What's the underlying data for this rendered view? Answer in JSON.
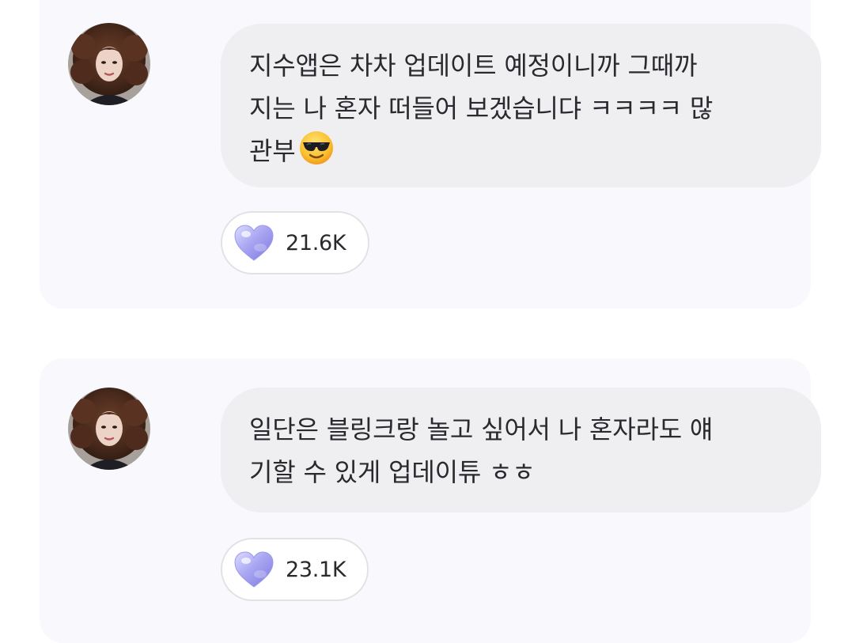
{
  "colors": {
    "card_background": "#f8f8fd",
    "bubble_background": "#efeff1",
    "text": "#2a2a2e",
    "heart": "#a9a6f2"
  },
  "messages": [
    {
      "author_icon": "avatar-icon",
      "lines": [
        "지수앱은 차차 업데이트 예정이니까 그때까",
        "지는 나 혼자 떠들어 보겠습니댜 ㅋㅋㅋㅋ 많",
        "관부"
      ],
      "trailing_emoji": "smiling-face-with-sunglasses-icon",
      "reaction_icon": "crystal-heart-icon",
      "like_count": "21.6K"
    },
    {
      "author_icon": "avatar-icon",
      "lines": [
        "일단은 블링크랑 놀고 싶어서 나 혼자라도 얘",
        "기할 수 있게 업데이튜 ㅎㅎ"
      ],
      "reaction_icon": "crystal-heart-icon",
      "like_count": "23.1K"
    }
  ]
}
